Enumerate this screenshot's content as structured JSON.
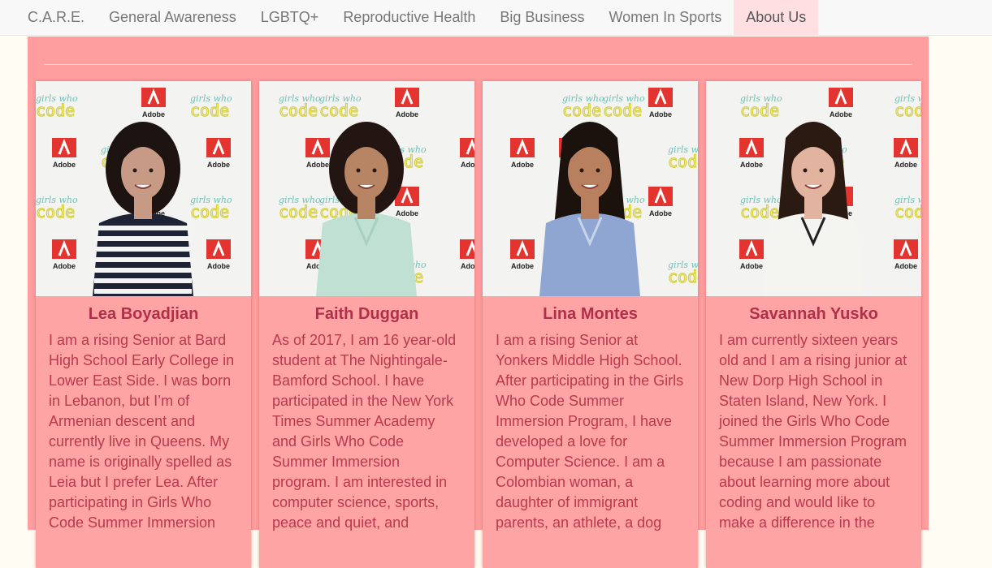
{
  "nav": {
    "items": [
      {
        "label": "C.A.R.E."
      },
      {
        "label": "General Awareness"
      },
      {
        "label": "LGBTQ+"
      },
      {
        "label": "Reproductive Health"
      },
      {
        "label": "Big Business"
      },
      {
        "label": "Women In Sports"
      },
      {
        "label": "About Us"
      }
    ],
    "active_color": "#ffdfe1"
  },
  "colors": {
    "page_background": "#fffdf3",
    "main_background": "#ff9d9f",
    "name_color": "#b0304a",
    "bio_color": "#b83a4d"
  },
  "backdrop_text": {
    "adobe": "Adobe",
    "girls": "girls who",
    "code": "code"
  },
  "members": [
    {
      "name": "Lea Boyadjian",
      "bio": "I am a rising Senior at Bard High School Early College in Lower East Side. I was born in Lebanon, but I’m of Armenian descent and currently live in Queens. My name is originally spelled as Leia but I prefer Lea. After participating in Girls Who Code Summer Immersion"
    },
    {
      "name": "Faith Duggan",
      "bio": "As of 2017, I am 16 year-old student at The Nightingale-Bamford School. I have participated in the New York Times Summer Academy and Girls Who Code Summer Immersion program. I am interested in computer science, sports, peace and quiet, and"
    },
    {
      "name": "Lina Montes",
      "bio": "I am a rising Senior at Yonkers Middle High School. After participating in the Girls Who Code Summer Immersion Program, I have developed a love for Computer Science. I am a Colombian woman, a daughter of immigrant parents, an athlete, a dog"
    },
    {
      "name": "Savannah Yusko",
      "bio": "I am currently sixteen years old and I am a rising junior at New Dorp High School in Staten Island, New York. I joined the Girls Who Code Summer Immersion Program because I am passionate about learning more about coding and would like to make a difference in the"
    }
  ]
}
